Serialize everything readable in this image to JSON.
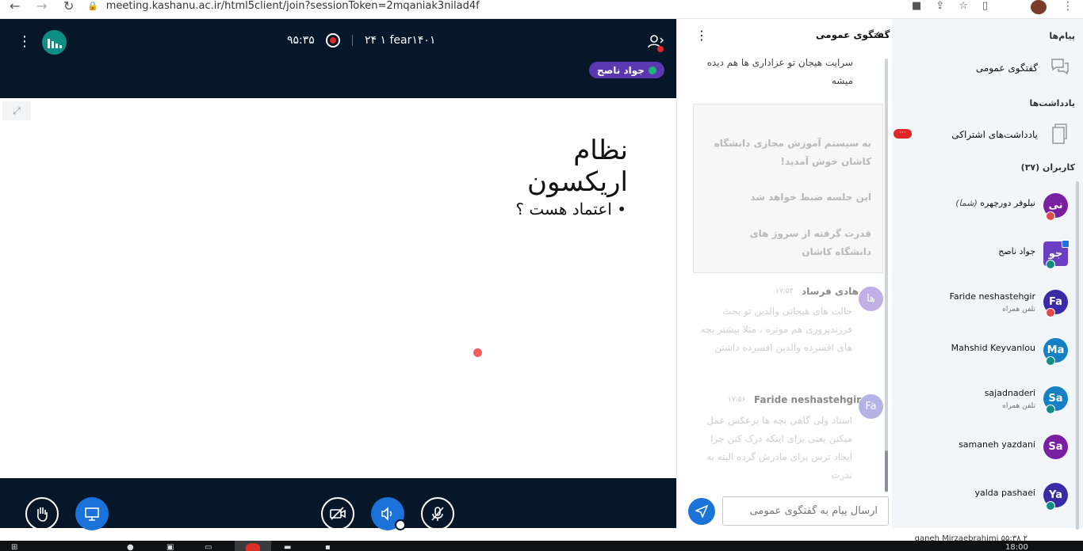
{
  "browser": {
    "url": "meeting.kashanu.ac.ir/html5client/join?sessionToken=2mqaniak3nilad4f"
  },
  "header": {
    "recording_time": "۹۵:۳۵",
    "date": "۲۴ ۱ fear۱۴۰۱",
    "presenter": "جواد ناصح"
  },
  "slide": {
    "title": "نظام اریکسون",
    "bullet": "• اعتماد هست ؟"
  },
  "chat": {
    "title": "گفتگوی عمومی",
    "first_message": "سرایت هیجان تو عزاداری ها هم دیده میشه",
    "welcome_line1": "به سیستم آموزش مجازی دانشگاه کاشان خوش آمدید!",
    "welcome_line2": "این جلسه ضبط خواهد شد",
    "welcome_line3": "قدرت گرفته از سروژ های دانشگاه کاشان",
    "messages": [
      {
        "avatar": "ها",
        "name": "هادی فرساد",
        "time": "۱۷:۵۳",
        "text": "حالت های هیجانی والدین تو بحث فرزندپروری هم موثره ، مثلا بیشتر بچه های افسرده والدین افسرده داشتن"
      },
      {
        "avatar": "Fa",
        "name": "Faride neshastehgir",
        "time": "۱۷:۵۶",
        "text": "استاد ولی گاهی بچه ها برعکس عمل میکنن یعنی برای اینکه درک کنن چرا ایجاد ترس برای مادرش گرده البته به ندرت"
      }
    ],
    "input_placeholder": "ارسال پیام به گفتگوی عمومی"
  },
  "sidebar": {
    "messages_heading": "پیام‌ها",
    "public_chat": "گفتگوی عمومی",
    "notes_heading": "یادداشت‌ها",
    "shared_notes": "یادداشت‌های اشتراکی",
    "users_heading": "کاربران (۳۷)",
    "users": [
      {
        "initials": "نی",
        "name": "نیلوفر دورچهره",
        "you_label": "(شما)",
        "sub": "",
        "color": "#7a1fa2",
        "badge": "#e24b4b",
        "square": false,
        "presenter": false
      },
      {
        "initials": "جو",
        "name": "جواد ناصح",
        "you_label": "",
        "sub": "",
        "color": "#6a3fc1",
        "badge": "#0f8e86",
        "square": true,
        "presenter": true
      },
      {
        "initials": "Fa",
        "name": "Faride neshastehgir",
        "you_label": "",
        "sub": "تلفن همراه",
        "color": "#3a2aa8",
        "badge": "#e24b4b",
        "square": false,
        "presenter": false
      },
      {
        "initials": "Ma",
        "name": "Mahshid Keyvanlou",
        "you_label": "",
        "sub": "",
        "color": "#1581c5",
        "badge": "#0f8e86",
        "square": false,
        "presenter": false
      },
      {
        "initials": "Sa",
        "name": "sajadnaderi",
        "you_label": "",
        "sub": "تلفن همراه",
        "color": "#1581c5",
        "badge": "#0f8e86",
        "square": false,
        "presenter": false
      },
      {
        "initials": "Sa",
        "name": "samaneh yazdani",
        "you_label": "",
        "sub": "",
        "color": "#7a1fa2",
        "badge": "",
        "square": false,
        "presenter": false
      },
      {
        "initials": "Ya",
        "name": "yalda pashaei",
        "you_label": "",
        "sub": "",
        "color": "#3a2aa8",
        "badge": "#0f8e86",
        "square": false,
        "presenter": false
      }
    ],
    "cut_off_user": "ganeh Mirzaebrahimi ۵۵:۳۸ ۲"
  },
  "taskbar": {
    "time": "18:00"
  }
}
